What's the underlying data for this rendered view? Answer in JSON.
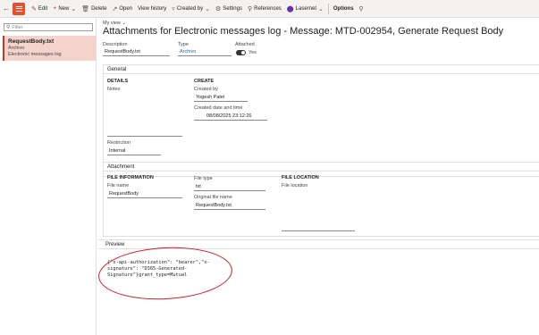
{
  "toolbar": {
    "edit": "Edit",
    "new": "New",
    "delete": "Delete",
    "open": "Open",
    "view_history": "View history",
    "created_by": "Created by",
    "settings": "Settings",
    "references": "References",
    "lasernet": "Lasernet",
    "options": "Options"
  },
  "leftpane": {
    "filter_placeholder": "Filter",
    "record": {
      "name": "RequestBody.txt",
      "type": "Archivo",
      "source": "Electronic messages log"
    }
  },
  "header": {
    "view": "My view",
    "title": "Attachments for Electronic messages log - Message: MTD-002954, Generate Request Body"
  },
  "fields": {
    "description_label": "Description",
    "description_value": "RequestBody.txt",
    "type_label": "Type",
    "type_value": "Archivo",
    "attached_label": "Attached",
    "attached_value": "Yes"
  },
  "general": {
    "heading": "General",
    "details_heading": "DETAILS",
    "notes_label": "Notes",
    "restriction_label": "Restriction",
    "restriction_value": "Internal",
    "create_heading": "CREATE",
    "created_by_label": "Created by",
    "created_by_value": "Yogesh Patel",
    "created_dt_label": "Created date and time",
    "created_dt_value": "08/08/2025 23:12:26"
  },
  "attachment": {
    "heading": "Attachment",
    "file_info_heading": "FILE INFORMATION",
    "file_name_label": "File name",
    "file_name_value": "RequestBody",
    "file_type_label": "File type",
    "file_type_value": "txt",
    "original_label": "Original file name",
    "original_value": "RequestBody.txt",
    "file_location_heading": "FILE LOCATION",
    "file_location_label": "File location"
  },
  "preview": {
    "heading": "Preview",
    "content": "{\"x-api-authorization\": \"bearer\",\"x-signature\": \"D365-Generated-Signature\"}grant_type=Mutual"
  },
  "colors": {
    "accent": "#e8502a",
    "selected_bg": "#f3d3cc",
    "annotation_circle": "#d71920",
    "link": "#2a62a8"
  }
}
